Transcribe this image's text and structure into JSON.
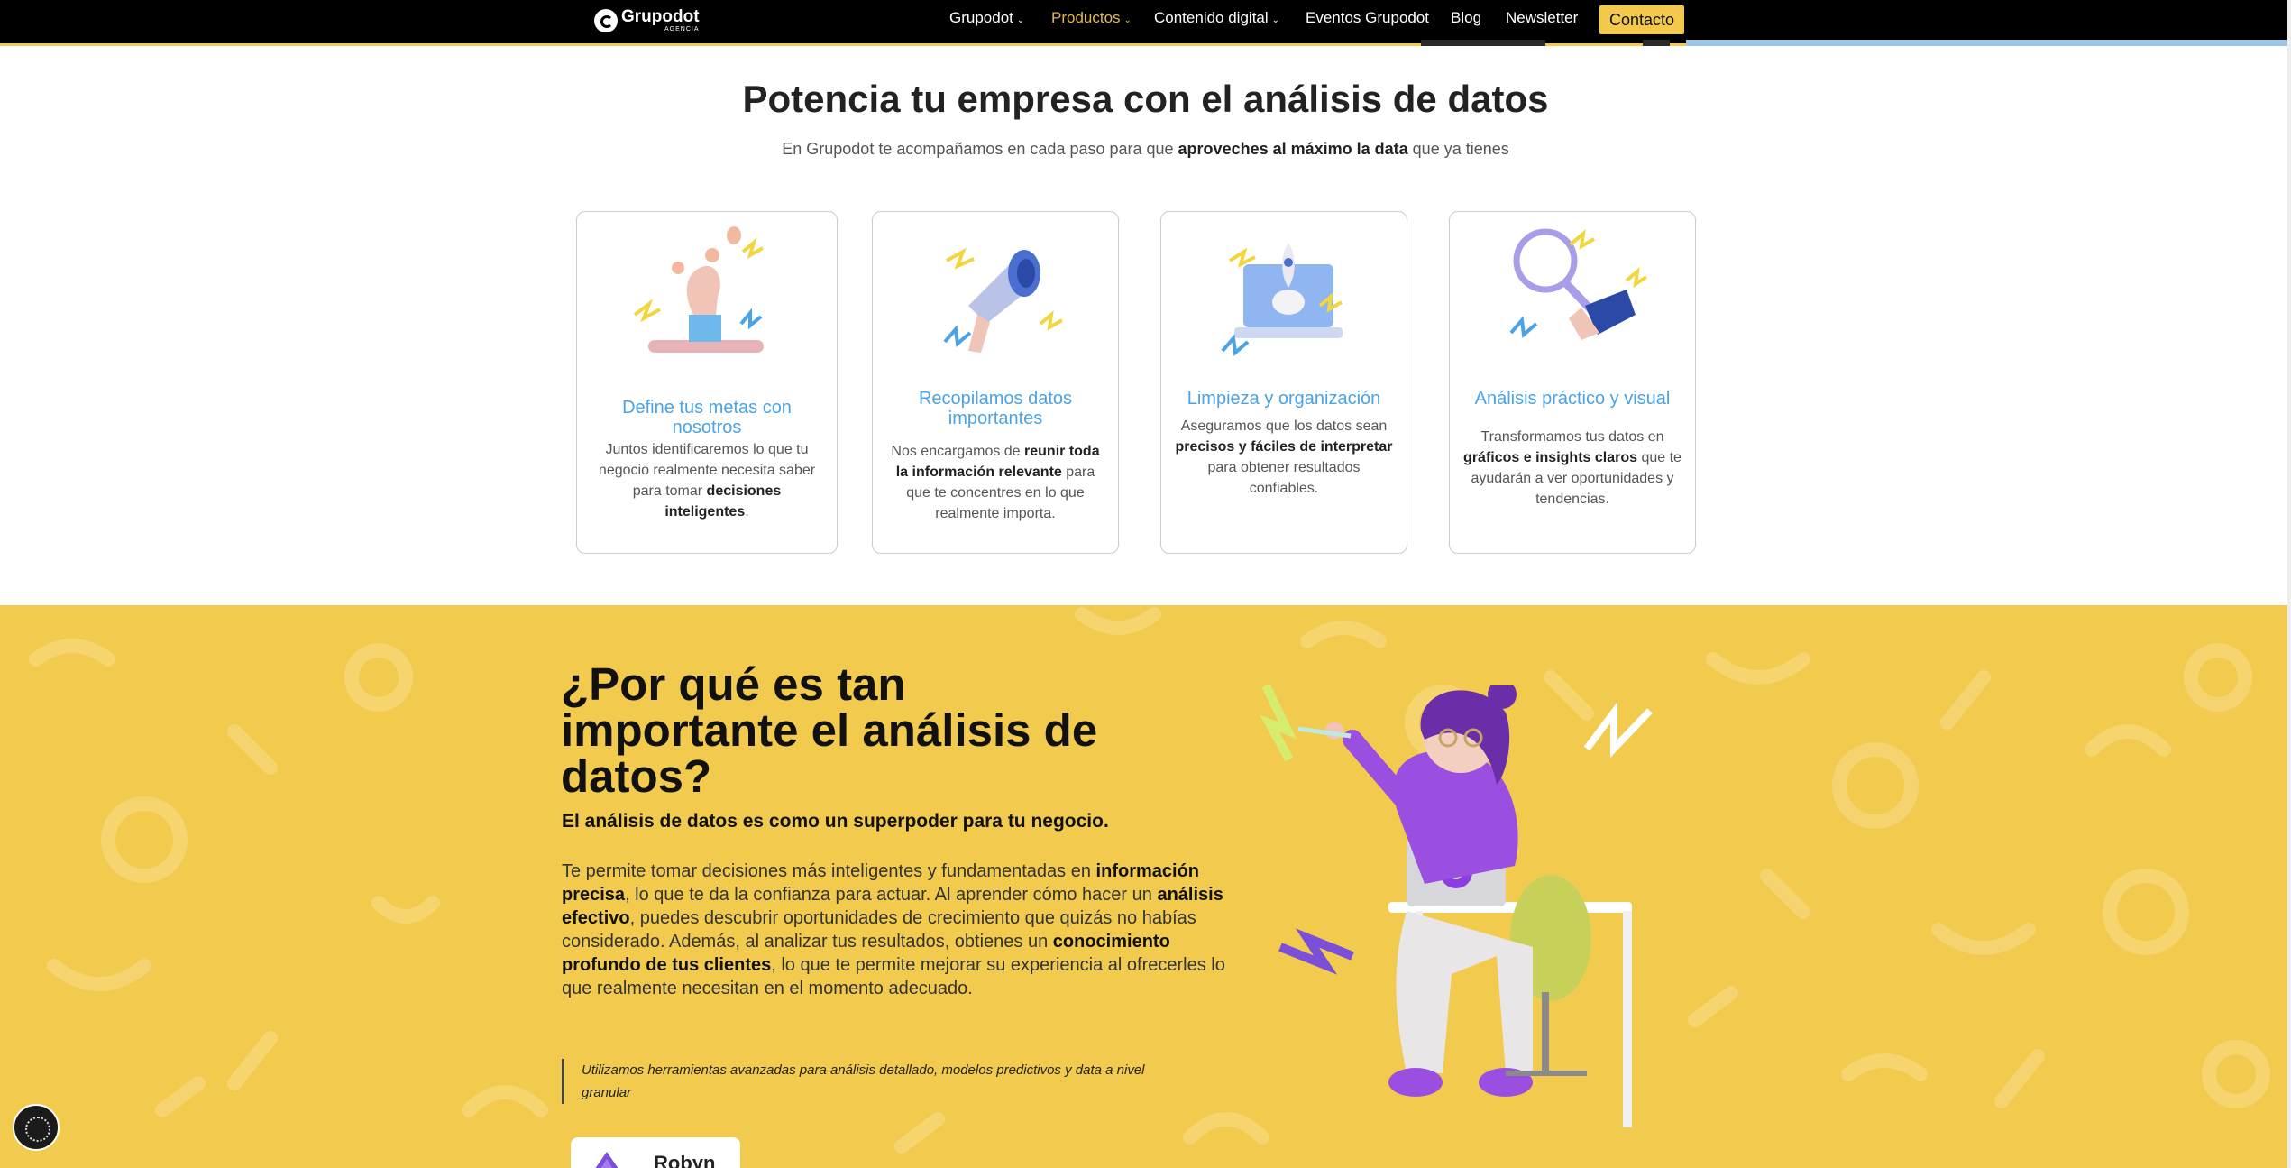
{
  "nav": {
    "logo": "Grupodot",
    "logo_sub": "AGENCIA",
    "items": [
      {
        "label": "Grupodot",
        "dropdown": true
      },
      {
        "label": "Productos",
        "dropdown": true
      },
      {
        "label": "Contenido digital",
        "dropdown": true
      },
      {
        "label": "Eventos Grupodot",
        "dropdown": false
      },
      {
        "label": "Blog",
        "dropdown": false
      },
      {
        "label": "Newsletter",
        "dropdown": false
      }
    ],
    "contact": "Contacto"
  },
  "hero": {
    "title": "Potencia tu empresa con el análisis de datos",
    "subtitle_pre": "En Grupodot te acompañamos en cada paso para que ",
    "subtitle_bold": "aproveches al máximo la data",
    "subtitle_post": " que ya tienes"
  },
  "cards": [
    {
      "title": "Define tus metas con nosotros",
      "t1": "Juntos identificaremos lo que tu negocio realmente necesita saber para tomar ",
      "b1": "decisiones inteligentes",
      "t2": ".",
      "b2": "",
      "t3": ""
    },
    {
      "title": "Recopilamos datos importantes",
      "t1": "Nos encargamos de ",
      "b1": "reunir toda la información relevante",
      "t2": " para que te concentres en lo que realmente importa.",
      "b2": "",
      "t3": ""
    },
    {
      "title": "Limpieza y organización",
      "t1": "Aseguramos que los datos sean ",
      "b1": "precisos y fáciles de interpretar",
      "t2": " para obtener resultados confiables.",
      "b2": "",
      "t3": ""
    },
    {
      "title": "Análisis práctico y visual",
      "t1": "Transformamos tus datos en ",
      "b1": "gráficos e insights claros",
      "t2": " que te ayudarán a ver oportunidades y tendencias.",
      "b2": "",
      "t3": ""
    }
  ],
  "why": {
    "title": "¿Por qué es tan importante el análisis de datos?",
    "lead": "El análisis de datos es como un superpoder para tu negocio.",
    "p1": "Te permite tomar decisiones más inteligentes y fundamentadas en ",
    "b1": "información precisa",
    "p2": ", lo que te da la confianza para actuar. Al aprender cómo hacer un ",
    "b2": "análisis efectivo",
    "p3": ", puedes descubrir oportunidades de crecimiento que quizás no habías considerado. Además, al analizar tus resultados, obtienes un ",
    "b3": "conocimiento profundo de tus clientes",
    "p4": ", lo que te permite mejorar su experiencia al ofrecerles lo que realmente necesitan en el momento adecuado.",
    "quote": "Utilizamos herramientas avanzadas para análisis detallado, modelos predictivos y data a nivel granular",
    "tool": "Robyn"
  },
  "colors": {
    "brand_yellow": "#f2ca4e",
    "card_title": "#4aa3e6",
    "nav_active": "#e8b84a"
  }
}
